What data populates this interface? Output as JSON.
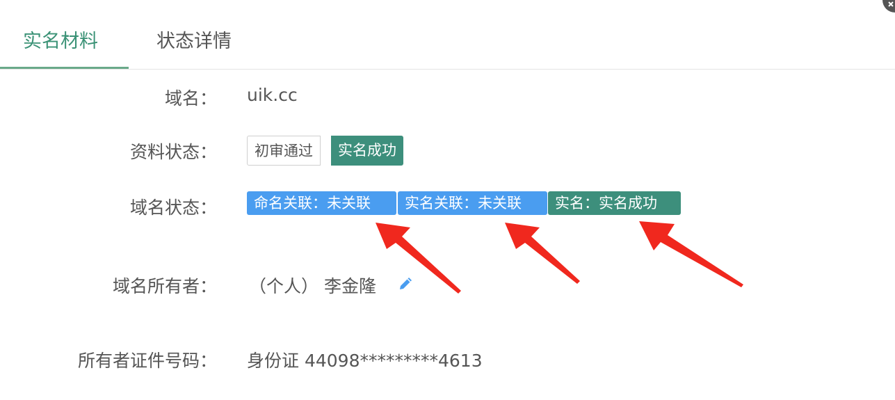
{
  "tabs": [
    {
      "label": "实名材料",
      "active": true
    },
    {
      "label": "状态详情",
      "active": false
    }
  ],
  "domain": {
    "label": "域名：",
    "value": "uik.cc"
  },
  "material_status": {
    "label": "资料状态：",
    "badges": [
      "初审通过",
      "实名成功"
    ]
  },
  "domain_status": {
    "label": "域名状态：",
    "badges": [
      "命名关联：未关联",
      "实名关联：未关联",
      "实名：实名成功"
    ]
  },
  "owner": {
    "label": "域名所有者：",
    "value": "（个人） 李金隆"
  },
  "owner_id": {
    "label": "所有者证件号码：",
    "value": "身份证 44098*********4613"
  },
  "colors": {
    "accent_green": "#3d8f7c",
    "tab_green": "#3b9276",
    "badge_blue": "#4a9df0",
    "arrow_red": "#f0281e"
  },
  "icons": {
    "edit": "pencil-icon",
    "corner": "close-icon"
  }
}
